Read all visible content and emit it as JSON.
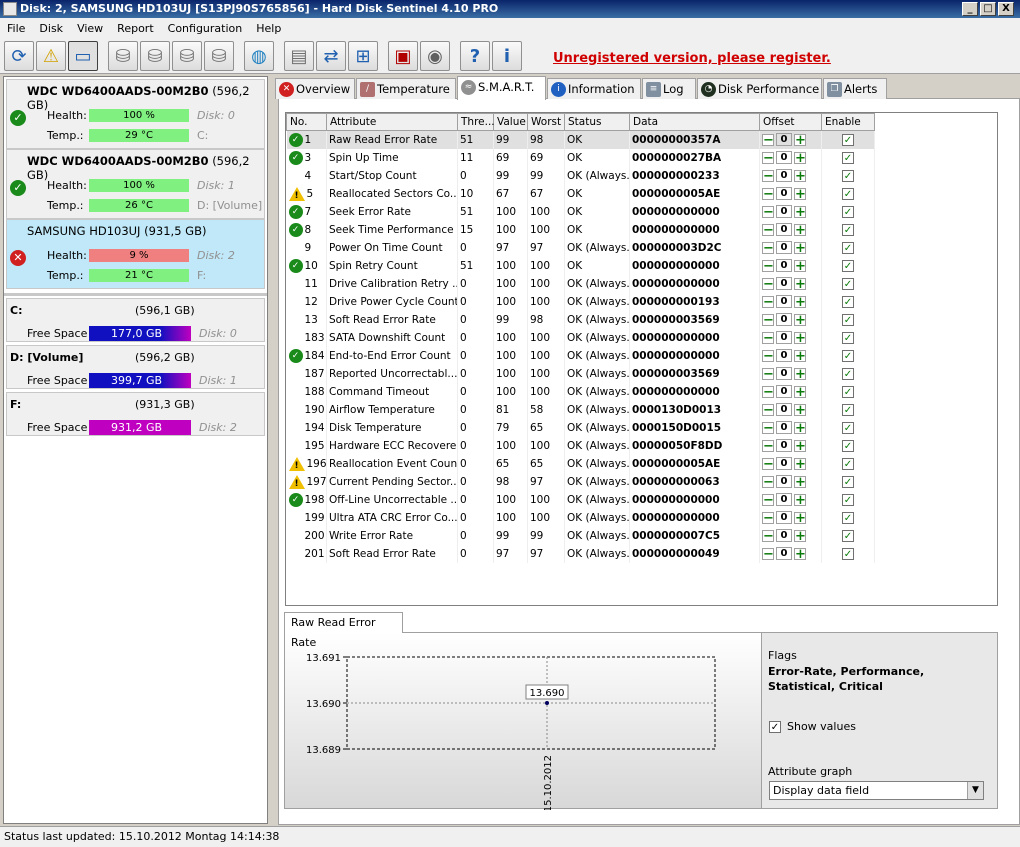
{
  "window": {
    "title": "Disk: 2, SAMSUNG HD103UJ [S13PJ90S765856]  -  Hard Disk Sentinel 4.10 PRO",
    "minimize": "_",
    "maximize": "□",
    "close": "X"
  },
  "menu": [
    "File",
    "Disk",
    "View",
    "Report",
    "Configuration",
    "Help"
  ],
  "toolbar": {
    "register": "Unregistered version, please register."
  },
  "disks": [
    {
      "name": "WDC WD6400AADS-00M2B0",
      "size": "(596,2 GB)",
      "health_label": "Health:",
      "health": "100 %",
      "health_pct": 100,
      "temp_label": "Temp.:",
      "temp": "29 °C",
      "disk": "Disk: 0",
      "volume": "C:",
      "status": "ok"
    },
    {
      "name": "WDC WD6400AADS-00M2B0",
      "size": "(596,2 GB)",
      "health_label": "Health:",
      "health": "100 %",
      "health_pct": 100,
      "temp_label": "Temp.:",
      "temp": "26 °C",
      "disk": "Disk: 1",
      "volume": "D: [Volume]",
      "status": "ok"
    },
    {
      "name": "SAMSUNG HD103UJ",
      "size": "(931,5 GB)",
      "health_label": "Health:",
      "health": "9 %",
      "health_pct": 9,
      "temp_label": "Temp.:",
      "temp": "21 °C",
      "disk": "Disk: 2",
      "volume": "F:",
      "status": "bad"
    }
  ],
  "partitions": [
    {
      "name": "C:",
      "size": "(596,1 GB)",
      "free_label": "Free Space",
      "free": "177,0 GB",
      "disk": "Disk: 0"
    },
    {
      "name": "D: [Volume]",
      "size": "(596,2 GB)",
      "free_label": "Free Space",
      "free": "399,7 GB",
      "disk": "Disk: 1"
    },
    {
      "name": "F:",
      "size": "(931,3 GB)",
      "free_label": "Free Space",
      "free": "931,2 GB",
      "disk": "Disk: 2"
    }
  ],
  "tabs": [
    "Overview",
    "Temperature",
    "S.M.A.R.T.",
    "Information",
    "Log",
    "Disk Performance",
    "Alerts"
  ],
  "columns": [
    "No.",
    "Attribute",
    "Thre...",
    "Value",
    "Worst",
    "Status",
    "Data",
    "Offset",
    "Enable"
  ],
  "rows": [
    {
      "icon": "ok",
      "no": "1",
      "attr": "Raw Read Error Rate",
      "thr": "51",
      "val": "99",
      "worst": "98",
      "status": "OK",
      "data": "00000000357A",
      "offset": "0"
    },
    {
      "icon": "ok",
      "no": "3",
      "attr": "Spin Up Time",
      "thr": "11",
      "val": "69",
      "worst": "69",
      "status": "OK",
      "data": "0000000027BA",
      "offset": "0"
    },
    {
      "icon": "",
      "no": "4",
      "attr": "Start/Stop Count",
      "thr": "0",
      "val": "99",
      "worst": "99",
      "status": "OK (Always...",
      "data": "000000000233",
      "offset": "0"
    },
    {
      "icon": "warn",
      "no": "5",
      "attr": "Reallocated Sectors Co...",
      "thr": "10",
      "val": "67",
      "worst": "67",
      "status": "OK",
      "data": "0000000005AE",
      "offset": "0"
    },
    {
      "icon": "ok",
      "no": "7",
      "attr": "Seek Error Rate",
      "thr": "51",
      "val": "100",
      "worst": "100",
      "status": "OK",
      "data": "000000000000",
      "offset": "0"
    },
    {
      "icon": "ok",
      "no": "8",
      "attr": "Seek Time Performance",
      "thr": "15",
      "val": "100",
      "worst": "100",
      "status": "OK",
      "data": "000000000000",
      "offset": "0"
    },
    {
      "icon": "",
      "no": "9",
      "attr": "Power On Time Count",
      "thr": "0",
      "val": "97",
      "worst": "97",
      "status": "OK (Always...",
      "data": "000000003D2C",
      "offset": "0"
    },
    {
      "icon": "ok",
      "no": "10",
      "attr": "Spin Retry Count",
      "thr": "51",
      "val": "100",
      "worst": "100",
      "status": "OK",
      "data": "000000000000",
      "offset": "0"
    },
    {
      "icon": "",
      "no": "11",
      "attr": "Drive Calibration Retry ...",
      "thr": "0",
      "val": "100",
      "worst": "100",
      "status": "OK (Always...",
      "data": "000000000000",
      "offset": "0"
    },
    {
      "icon": "",
      "no": "12",
      "attr": "Drive Power Cycle Count",
      "thr": "0",
      "val": "100",
      "worst": "100",
      "status": "OK (Always...",
      "data": "000000000193",
      "offset": "0"
    },
    {
      "icon": "",
      "no": "13",
      "attr": "Soft Read Error Rate",
      "thr": "0",
      "val": "99",
      "worst": "98",
      "status": "OK (Always...",
      "data": "000000003569",
      "offset": "0"
    },
    {
      "icon": "",
      "no": "183",
      "attr": "SATA Downshift Count",
      "thr": "0",
      "val": "100",
      "worst": "100",
      "status": "OK (Always...",
      "data": "000000000000",
      "offset": "0"
    },
    {
      "icon": "ok",
      "no": "184",
      "attr": "End-to-End Error Count",
      "thr": "0",
      "val": "100",
      "worst": "100",
      "status": "OK (Always...",
      "data": "000000000000",
      "offset": "0"
    },
    {
      "icon": "",
      "no": "187",
      "attr": "Reported Uncorrectabl...",
      "thr": "0",
      "val": "100",
      "worst": "100",
      "status": "OK (Always...",
      "data": "000000003569",
      "offset": "0"
    },
    {
      "icon": "",
      "no": "188",
      "attr": "Command Timeout",
      "thr": "0",
      "val": "100",
      "worst": "100",
      "status": "OK (Always...",
      "data": "000000000000",
      "offset": "0"
    },
    {
      "icon": "",
      "no": "190",
      "attr": "Airflow Temperature",
      "thr": "0",
      "val": "81",
      "worst": "58",
      "status": "OK (Always...",
      "data": "0000130D0013",
      "offset": "0"
    },
    {
      "icon": "",
      "no": "194",
      "attr": "Disk Temperature",
      "thr": "0",
      "val": "79",
      "worst": "65",
      "status": "OK (Always...",
      "data": "0000150D0015",
      "offset": "0"
    },
    {
      "icon": "",
      "no": "195",
      "attr": "Hardware ECC Recovered",
      "thr": "0",
      "val": "100",
      "worst": "100",
      "status": "OK (Always...",
      "data": "00000050F8DD",
      "offset": "0"
    },
    {
      "icon": "warn",
      "no": "196",
      "attr": "Reallocation Event Count",
      "thr": "0",
      "val": "65",
      "worst": "65",
      "status": "OK (Always...",
      "data": "0000000005AE",
      "offset": "0"
    },
    {
      "icon": "warn",
      "no": "197",
      "attr": "Current Pending Sector...",
      "thr": "0",
      "val": "98",
      "worst": "97",
      "status": "OK (Always...",
      "data": "000000000063",
      "offset": "0"
    },
    {
      "icon": "ok",
      "no": "198",
      "attr": "Off-Line Uncorrectable ...",
      "thr": "0",
      "val": "100",
      "worst": "100",
      "status": "OK (Always...",
      "data": "000000000000",
      "offset": "0"
    },
    {
      "icon": "",
      "no": "199",
      "attr": "Ultra ATA CRC Error Co...",
      "thr": "0",
      "val": "100",
      "worst": "100",
      "status": "OK (Always...",
      "data": "000000000000",
      "offset": "0"
    },
    {
      "icon": "",
      "no": "200",
      "attr": "Write Error Rate",
      "thr": "0",
      "val": "99",
      "worst": "99",
      "status": "OK (Always...",
      "data": "0000000007C5",
      "offset": "0"
    },
    {
      "icon": "",
      "no": "201",
      "attr": "Soft Read Error Rate",
      "thr": "0",
      "val": "97",
      "worst": "97",
      "status": "OK (Always...",
      "data": "000000000049",
      "offset": "0"
    }
  ],
  "graph": {
    "tab": "Raw Read Error Rate",
    "flags_label": "Flags",
    "flags": "Error-Rate, Performance, Statistical, Critical",
    "show_values": "Show values",
    "attr_graph_label": "Attribute graph",
    "attr_graph_value": "Display data field"
  },
  "chart_data": {
    "type": "line",
    "x": [
      "15.10.2012"
    ],
    "series": [
      {
        "values": [
          13.69
        ]
      }
    ],
    "yticks": [
      "13.691",
      "13.690",
      "13.689"
    ],
    "ylim": [
      13.689,
      13.691
    ],
    "point_label": "13.690",
    "grid": true
  },
  "status": "Status last updated: 15.10.2012 Montag 14:14:38",
  "colors": {
    "health_good": "#80f080",
    "health_bad": "#f08080",
    "temp": "#80f080",
    "accent": "#0a246a"
  }
}
